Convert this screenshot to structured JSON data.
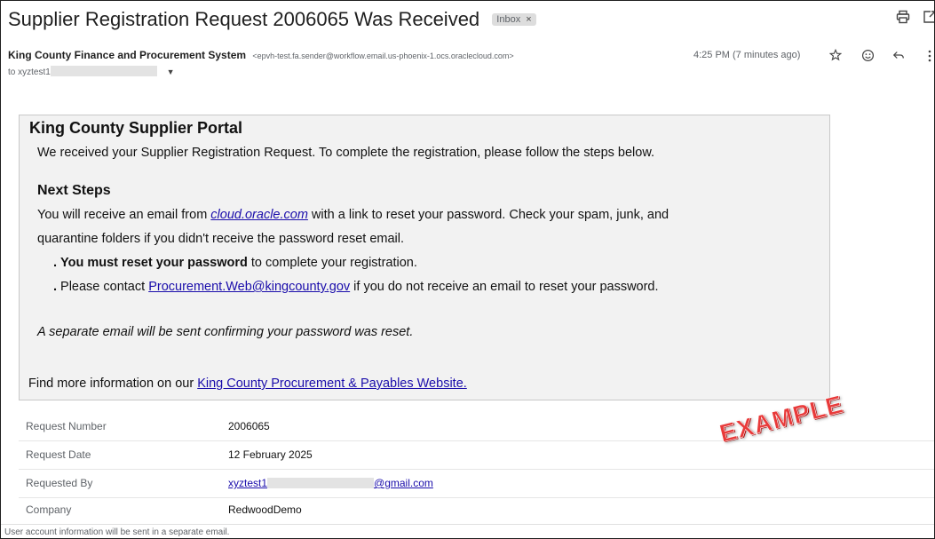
{
  "email": {
    "subject": "Supplier Registration Request 2006065 Was Received",
    "label_chip": "Inbox",
    "label_chip_close": "×",
    "sender_name": "King County Finance and Procurement System",
    "sender_email": "<epvh-test.fa.sender@workflow.email.us-phoenix-1.ocs.oraclecloud.com>",
    "to_prefix": "to xyztest1",
    "timestamp": "4:25 PM (7 minutes ago)"
  },
  "icons": {
    "print": "print-icon",
    "open_new": "open-in-new-window-icon",
    "star": "star-icon",
    "emoji": "emoji-reaction-icon",
    "reply": "reply-icon",
    "more": "more-vert-icon",
    "details_dropdown": "chevron-down-icon"
  },
  "portal": {
    "title": "King County Supplier Portal",
    "intro": "We received your Supplier Registration Request. To complete the registration, please follow the steps below.",
    "next_steps_heading": "Next Steps",
    "reset_prefix": "You will receive an email from ",
    "reset_link": "cloud.oracle.com",
    "reset_suffix": " with a link to reset your password. Check your spam, junk, and",
    "reset_line2": "quarantine folders if you didn't receive the password reset email.",
    "bullet1_bold": "You must reset your password",
    "bullet1_rest": " to complete your registration.",
    "bullet2_prefix": "Please contact ",
    "bullet2_link": "Procurement.Web@kingcounty.gov",
    "bullet2_suffix": " if you do not receive an email to reset your password.",
    "separate_note": "A separate email will be sent confirming your password was reset.",
    "find_more_prefix": "Find more information on our ",
    "find_more_link": "King County Procurement & Payables Website."
  },
  "details": [
    {
      "label": "Request Number",
      "value": "2006065"
    },
    {
      "label": "Request Date",
      "value": "12 February 2025"
    },
    {
      "label": "Requested By",
      "value_prefix": "xyztest1",
      "value_suffix": "@gmail.com"
    },
    {
      "label": "Company",
      "value": "RedwoodDemo"
    }
  ],
  "stamp": "EXAMPLE",
  "footer_note": "User account information will be sent in a separate email.",
  "colors": {
    "link": "#1a0dab",
    "portal_bg": "#f2f2f2",
    "stamp": "#e83a3a",
    "redaction": "#e3e3e3"
  }
}
